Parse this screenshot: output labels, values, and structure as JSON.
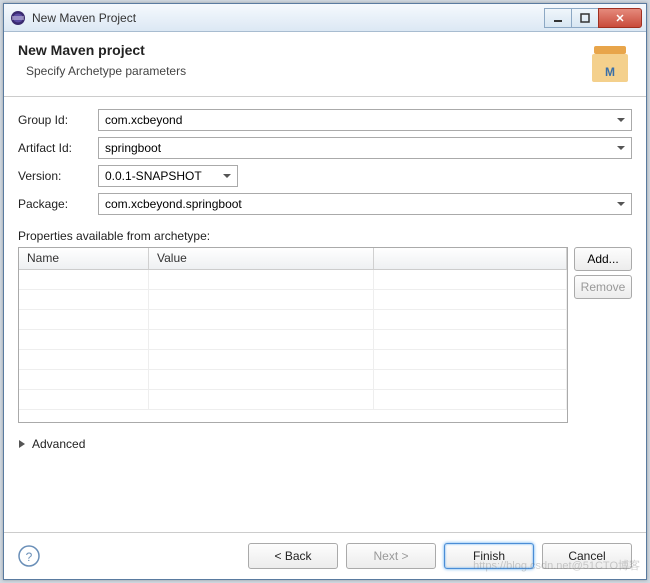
{
  "window": {
    "title": "New Maven Project"
  },
  "header": {
    "title": "New Maven project",
    "subtitle": "Specify Archetype parameters"
  },
  "form": {
    "groupId": {
      "label": "Group Id:",
      "value": "com.xcbeyond"
    },
    "artifactId": {
      "label": "Artifact Id:",
      "value": "springboot"
    },
    "version": {
      "label": "Version:",
      "value": "0.0.1-SNAPSHOT"
    },
    "package": {
      "label": "Package:",
      "value": "com.xcbeyond.springboot"
    }
  },
  "properties": {
    "label": "Properties available from archetype:",
    "columns": {
      "name": "Name",
      "value": "Value"
    },
    "buttons": {
      "add": "Add...",
      "remove": "Remove"
    }
  },
  "advanced": {
    "label": "Advanced"
  },
  "footer": {
    "back": "< Back",
    "next": "Next >",
    "finish": "Finish",
    "cancel": "Cancel"
  },
  "watermark": "https://blog.csdn.net@51CTO博客"
}
